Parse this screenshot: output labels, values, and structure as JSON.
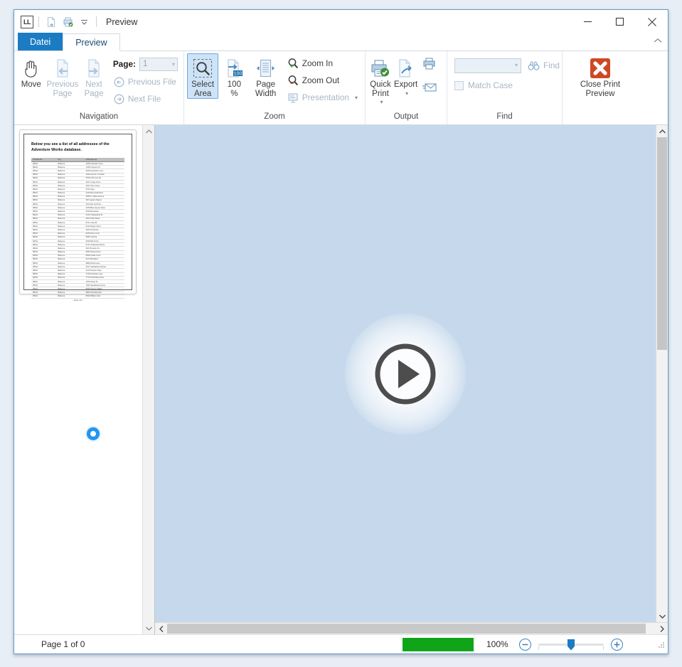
{
  "window": {
    "title": "Preview",
    "logo_text": "LL",
    "quick_access": [
      "document-export-icon",
      "print-setup-icon",
      "qat-dropdown-icon"
    ],
    "controls": {
      "minimize": "minimize-icon",
      "maximize": "maximize-icon",
      "close": "close-icon"
    },
    "ribbon_collapse": "chevron-up-icon"
  },
  "tabs": [
    {
      "label": "Datei",
      "name": "tab-datei",
      "state": "file-menu"
    },
    {
      "label": "Preview",
      "name": "tab-preview",
      "state": "active"
    }
  ],
  "ribbon": {
    "groups": [
      {
        "label": "Navigation",
        "name": "ribbon-group-navigation",
        "big_buttons": [
          {
            "label": "Move",
            "name": "move-button",
            "icon": "hand-icon",
            "disabled": false
          },
          {
            "label": "Previous\nPage",
            "name": "previous-page-button",
            "icon": "page-left-arrow-icon",
            "disabled": true
          },
          {
            "label": "Next\nPage",
            "name": "next-page-button",
            "icon": "page-right-arrow-icon",
            "disabled": true
          }
        ],
        "page_field": {
          "label": "Page:",
          "value": "1",
          "disabled": true
        },
        "small_buttons": [
          {
            "label": "Previous File",
            "name": "previous-file-button",
            "icon": "circle-left-arrow-icon",
            "disabled": true
          },
          {
            "label": "Next File",
            "name": "next-file-button",
            "icon": "circle-right-arrow-icon",
            "disabled": true
          }
        ]
      },
      {
        "label": "Zoom",
        "name": "ribbon-group-zoom",
        "big_buttons": [
          {
            "label": "Select\nArea",
            "name": "select-area-button",
            "icon": "magnifier-marquee-icon",
            "checked": true
          },
          {
            "label": "100\n%",
            "name": "zoom-100-percent-button",
            "icon": "page-100-icon",
            "disabled": false
          },
          {
            "label": "Page\nWidth",
            "name": "page-width-button",
            "icon": "page-width-icon",
            "disabled": false
          }
        ],
        "small_buttons": [
          {
            "label": "Zoom In",
            "name": "zoom-in-button",
            "icon": "magnifier-plus-icon",
            "disabled": false
          },
          {
            "label": "Zoom Out",
            "name": "zoom-out-button",
            "icon": "magnifier-minus-icon",
            "disabled": false
          },
          {
            "label": "Presentation",
            "name": "presentation-button",
            "icon": "presentation-icon",
            "disabled": true,
            "has_dropdown": true
          }
        ]
      },
      {
        "label": "Output",
        "name": "ribbon-group-output",
        "big_buttons": [
          {
            "label": "Quick\nPrint",
            "name": "quick-print-button",
            "icon": "printer-check-icon",
            "has_dropdown": true
          },
          {
            "label": "Export",
            "name": "export-button",
            "icon": "page-export-icon",
            "has_dropdown": true
          }
        ],
        "small_buttons": [
          {
            "label": "",
            "name": "print-button",
            "icon": "printer-icon",
            "disabled": false
          },
          {
            "label": "",
            "name": "send-mail-button",
            "icon": "envelope-icon",
            "disabled": false
          }
        ]
      },
      {
        "label": "Find",
        "name": "ribbon-group-find",
        "search_combo": {
          "value": "",
          "placeholder": "",
          "disabled": true
        },
        "find_button": {
          "label": "Find",
          "name": "find-button",
          "icon": "binoculars-icon",
          "disabled": true
        },
        "match_case": {
          "label": "Match Case",
          "checked": false,
          "disabled": true
        }
      },
      {
        "label": "",
        "name": "ribbon-group-close",
        "big_buttons": [
          {
            "label": "Close Print\nPreview",
            "name": "close-print-preview-button",
            "icon": "red-x-icon",
            "disabled": false
          }
        ]
      }
    ]
  },
  "thumbnail_pane": {
    "name": "thumbnail-pane",
    "page": {
      "title": "Below you see a list of all addresses of the Adventure Works database.",
      "columns": [
        "PostalCode",
        "City",
        "AddressLine1"
      ],
      "rows": [
        [
          "98011",
          "Bellevue",
          "3298 Lakeside Court"
        ],
        [
          "98011",
          "Bellevue",
          "1345 Prospect St."
        ],
        [
          "98011",
          "Bellevue",
          "9949 Southside Lane"
        ],
        [
          "98011",
          "Bellevue",
          "1294 Avenue of Avalon"
        ],
        [
          "98011",
          "Bellevue",
          "2573 14Th Ave Ne"
        ],
        [
          "98011",
          "Bellevue",
          "2647 Lange Drive"
        ],
        [
          "98011",
          "Bellevue",
          "3647 Pine Lanes"
        ],
        [
          "98011",
          "Bellevue",
          "9751 Skye"
        ],
        [
          "98011",
          "Bellevue",
          "2130 Memorial Place"
        ],
        [
          "98011",
          "Bellevue",
          "4095 S. Idaho Avenue"
        ],
        [
          "98011",
          "Bellevue",
          "202 Laguna Niguel"
        ],
        [
          "98011",
          "Bellevue",
          "3014 Del Sol Drive"
        ],
        [
          "98011",
          "Bellevue",
          "4678 Blue Spruce Drive"
        ],
        [
          "98011",
          "Bellevue",
          "6158 Woodvale"
        ],
        [
          "98011",
          "Bellevue",
          "2119 Collingwood Dr"
        ],
        [
          "98011",
          "Bellevue",
          "2912 Polar Road"
        ],
        [
          "98011",
          "Bellevue",
          "8711 Cole Rd"
        ],
        [
          "98011",
          "Bellevue",
          "6113 Roslyn Drive"
        ],
        [
          "98011",
          "Bellevue",
          "3623 Northview"
        ],
        [
          "98011",
          "Bellevue",
          "9678 Olive Court"
        ],
        [
          "98011",
          "Bellevue",
          "6965 Viewing"
        ],
        [
          "98011",
          "Bellevue",
          "6158 Mill Circle"
        ],
        [
          "98011",
          "Bellevue",
          "8714 Cedarwood Drive"
        ],
        [
          "98011",
          "Bellevue",
          "925 Princeton Ct."
        ],
        [
          "98011",
          "Bellevue",
          "6097 Desert Drive"
        ],
        [
          "98011",
          "Bellevue",
          "8645 Castle Court"
        ],
        [
          "98011",
          "Bellevue",
          "6174 Brookline"
        ],
        [
          "98011",
          "Bellevue",
          "9886 Wood Lane"
        ],
        [
          "98011",
          "Bellevue",
          "4517 Sandalwood Street"
        ],
        [
          "98011",
          "Bellevue",
          "2213 Paupers Way"
        ],
        [
          "98011",
          "Bellevue",
          "7138 Gresham Lane"
        ],
        [
          "98011",
          "Bellevue",
          "7773 Northridge Drive"
        ],
        [
          "98011",
          "Bellevue",
          "1916 Street St."
        ],
        [
          "98011",
          "Bellevue",
          "7926 Sandalwood Lane"
        ],
        [
          "98011",
          "Bellevue",
          "8635 Pasture Walks"
        ],
        [
          "98011",
          "Bellevue",
          "8868 Oak Barracks"
        ],
        [
          "98011",
          "Bellevue",
          "8649 William Cart"
        ]
      ],
      "footer": "- Seite 1/2 -"
    },
    "cursor": "loading-ring-cursor",
    "scroll": {
      "up": "chevron-up-icon",
      "down": "chevron-down-icon",
      "thumb_visible": false
    }
  },
  "preview": {
    "name": "preview-canvas",
    "background_color": "#c6d9ec",
    "play_overlay": {
      "name": "play-button-overlay",
      "icon": "play-circle-icon"
    },
    "vertical_scroll": {
      "thumb_top_pct": 0,
      "thumb_height_pct": 45
    },
    "horizontal_scroll": {
      "thumb_left_pct": 0,
      "thumb_width_pct": 98
    }
  },
  "statusbar": {
    "page_status": "Page 1 of 0",
    "progress": {
      "value_pct": 100,
      "color": "#10a519"
    },
    "zoom_label": "100%",
    "zoom_out": "zoom-out-circle-icon",
    "zoom_in": "zoom-in-circle-icon",
    "zoom_slider_value": 50,
    "grip": "resize-grip-icon"
  }
}
